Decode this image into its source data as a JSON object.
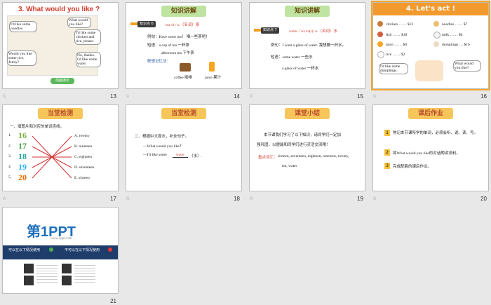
{
  "slides": [
    {
      "num": "13",
      "title": "3. What would you like ?",
      "b1": "I'd like some noodles.",
      "b2": "What would you like?",
      "b3": "I'd like some chicken and rice, please.",
      "b4": "Would you like some rice, Jenny?",
      "b5": "No, thanks. I'd like some water.",
      "button": "动画演示"
    },
    {
      "num": "14",
      "title": "知识讲解",
      "badge": "知识点 6",
      "headword": "tea /tiː/ n.（名词）茶",
      "l1": "例句：Have some tea！ 喝一些茶吧！",
      "l2": "短语：a cup of tea 一杯茶",
      "l3": "afternoon tea 下午茶",
      "l4": "联想记忆法：",
      "w1": "coffee 咖啡",
      "w2": "juice 果汁"
    },
    {
      "num": "15",
      "title": "知识讲解",
      "badge": "知识点 7",
      "headword": "water /ˈwɔːtə(r)/ n.（名词）水",
      "l1": "例句：I want a glass of water. 我想要一杯水。",
      "l2": "短语：some water 一些水",
      "l3": "a glass of water 一杯水"
    },
    {
      "num": "16",
      "title": "4. Let's act !",
      "i1": "chicken …… $12",
      "i2": "noodles …… $7",
      "i3": "fish …… $18",
      "i4": "milk …… $6",
      "i5": "juice …… $8",
      "i6": "dumplings … $16",
      "i7": "rice …… $2",
      "q1": "I'd like some dumplings.",
      "q2": "What would you like?"
    },
    {
      "num": "17",
      "title": "当堂检测",
      "inst": "一、填图片和对应的单词连线。",
      "n1": "16",
      "n2": "17",
      "n3": "18",
      "n4": "19",
      "n5": "20",
      "ln1": "1.",
      "ln2": "2.",
      "ln3": "3.",
      "ln4": "4.",
      "ln5": "5.",
      "o1": "A. twenty",
      "o2": "B. nineteen",
      "o3": "C. eighteen",
      "o4": "D. seventeen",
      "o5": "E. sixteen"
    },
    {
      "num": "18",
      "title": "当堂检测",
      "inst": "二、根据中文提示，补全句子。",
      "l1": "—What would you like？",
      "l2a": "—I'd like some",
      "ans": "water",
      "l2b": "（水）."
    },
    {
      "num": "19",
      "title": "课堂小结",
      "p1": "本节课我们学习了以下知识，请同学们一定加",
      "p2": "强巩固，以便能和同学们进行灵活交流哦！",
      "k": "重点词汇：",
      "kw": "sixteen, seventeen, eighteen, nineteen, twenty,",
      "kw2": "tea, water"
    },
    {
      "num": "20",
      "title": "课后作业",
      "h1": "熟记本节课所学的单词，必须会听、说、读、写。",
      "h2": "将What would you like的对话朗读流利。",
      "h3": "完成配套的课后作业。",
      "m1": "1",
      "m2": "2",
      "m3": "3"
    },
    {
      "num": "21",
      "logo": "第1PPT",
      "url": "www.1ppt.com",
      "can": "可以在以下情况使用",
      "cannot": "不可以在以下情况使用"
    }
  ],
  "star_icon": "☆",
  "colors": {
    "accent": "#f3a629",
    "blue": "#1e6fbd",
    "red": "#d23a2a"
  }
}
